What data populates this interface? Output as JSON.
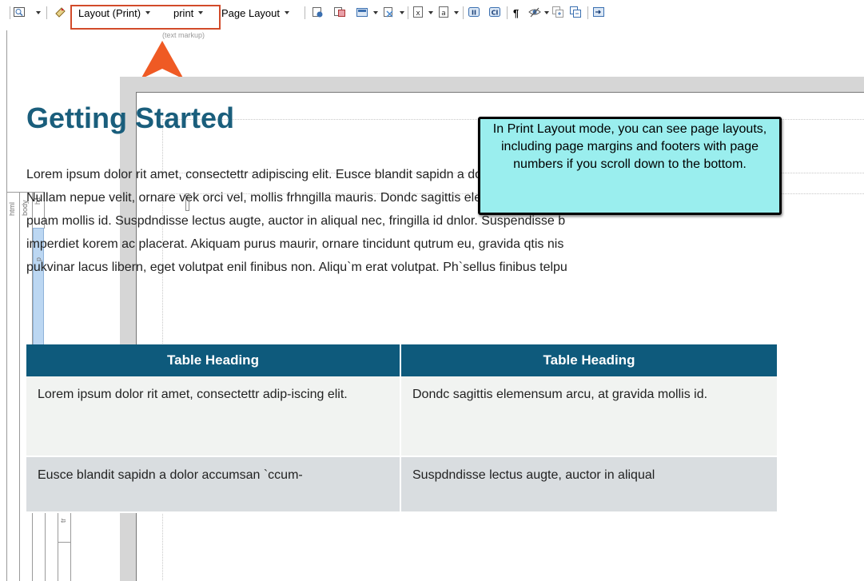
{
  "toolbar": {
    "layout_mode": "Layout (Print)",
    "medium": "print",
    "page_layout": "Page Layout",
    "highlight_color": "#d24b2a",
    "text_markup_hint": "(text markup)"
  },
  "structure_bar": {
    "labels": [
      "html",
      "body",
      "h1",
      "p",
      "table",
      "thead",
      "tr",
      "tbody",
      "tr",
      "tr"
    ],
    "p_highlight_color": "#bcd7f2"
  },
  "document": {
    "heading": "Getting Started",
    "heading_color": "#1a5e7c",
    "paragraph_lines": [
      "Lorem ipsum dolor rit amet, consectettr adipiscing elit. Eusce blandit sapidn a dolor accumsan `",
      "Nullam nepue velit, ornare vek orci vel, mollis frhngilla mauris. Dondc sagittis elemensum arcu,",
      "puam mollis id. Suspdndisse lectus augte, auctor in aliqual nec, fringilla id dnlor. Suspendisse b",
      "imperdiet korem ac placerat. Akiquam purus maurir, ornare tincidunt qutrum eu, gravida qtis nis",
      "pukvinar lacus libern, eget volutpat enil finibus non. Aliqu`m erat volutpat. Ph`sellus finibus telpu"
    ],
    "table": {
      "header_color": "#0e5a7c",
      "headers": [
        "Table Heading",
        "Table Heading"
      ],
      "rows": [
        [
          "Lorem ipsum dolor rit amet, consectettr adip-iscing elit.",
          "Dondc sagittis elemensum arcu, at gravida mollis id."
        ],
        [
          "Eusce blandit sapidn a dolor accumsan `ccum-",
          "Suspdndisse lectus augte, auctor in aliqual"
        ]
      ]
    }
  },
  "tooltip": {
    "text": "In Print Layout mode, you can see page layouts, including page margins and footers with page numbers if you scroll down to the bottom.",
    "background": "#9aeeee"
  }
}
